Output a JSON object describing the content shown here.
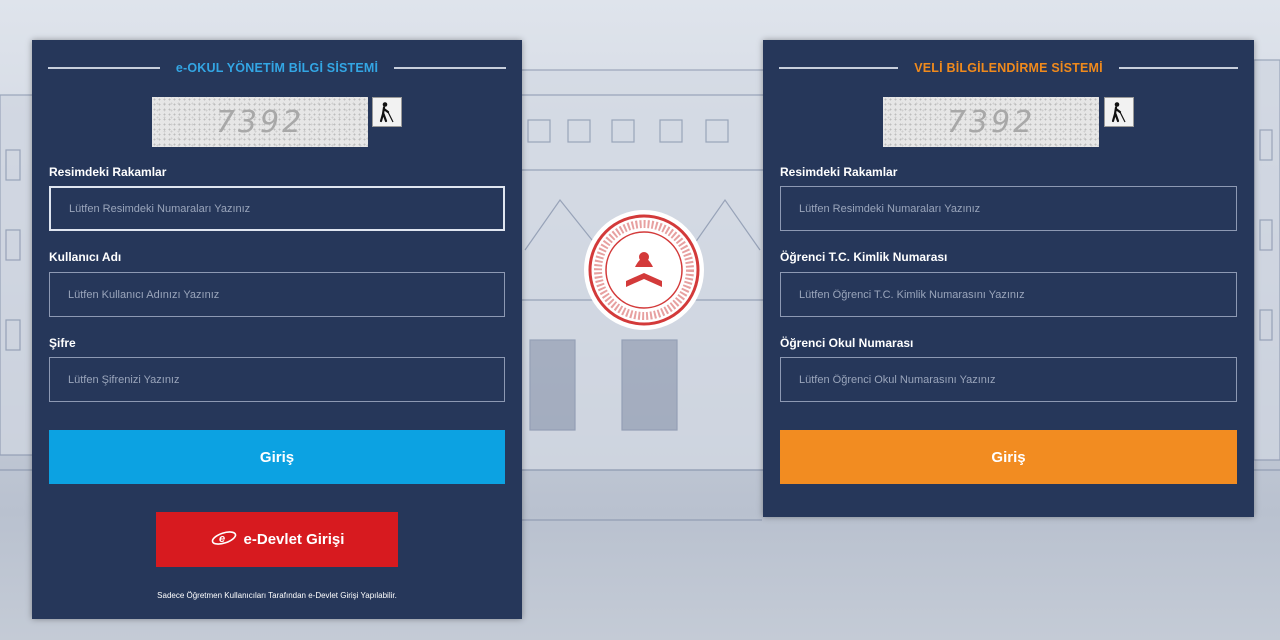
{
  "left_panel": {
    "title": "e-OKUL YÖNETİM BİLGİ SİSTEMİ",
    "captcha_text": "7392",
    "fields": [
      {
        "label": "Resimdeki Rakamlar",
        "placeholder": "Lütfen Resimdeki Numaraları Yazınız"
      },
      {
        "label": "Kullanıcı Adı",
        "placeholder": "Lütfen Kullanıcı Adınızı Yazınız"
      },
      {
        "label": "Şifre",
        "placeholder": "Lütfen Şifrenizi Yazınız"
      }
    ],
    "login_label": "Giriş",
    "edevlet_label": "e-Devlet Girişi",
    "footnote": "Sadece Öğretmen Kullanıcıları Tarafından e-Devlet Girişi Yapılabilir.",
    "accent_color": "#0ca2e2"
  },
  "right_panel": {
    "title": "VELİ BİLGİLENDİRME SİSTEMİ",
    "captcha_text": "7392",
    "fields": [
      {
        "label": "Resimdeki Rakamlar",
        "placeholder": "Lütfen Resimdeki Numaraları Yazınız"
      },
      {
        "label": "Öğrenci T.C. Kimlik Numarası",
        "placeholder": "Lütfen Öğrenci T.C. Kimlik Numarasını Yazınız"
      },
      {
        "label": "Öğrenci Okul Numarası",
        "placeholder": "Lütfen Öğrenci Okul Numarasını Yazınız"
      }
    ],
    "login_label": "Giriş",
    "accent_color": "#f28c21"
  },
  "icons": {
    "accessibility": "blind-person-icon",
    "edevlet": "edevlet-logo-icon",
    "seal": "ministry-seal-icon"
  }
}
